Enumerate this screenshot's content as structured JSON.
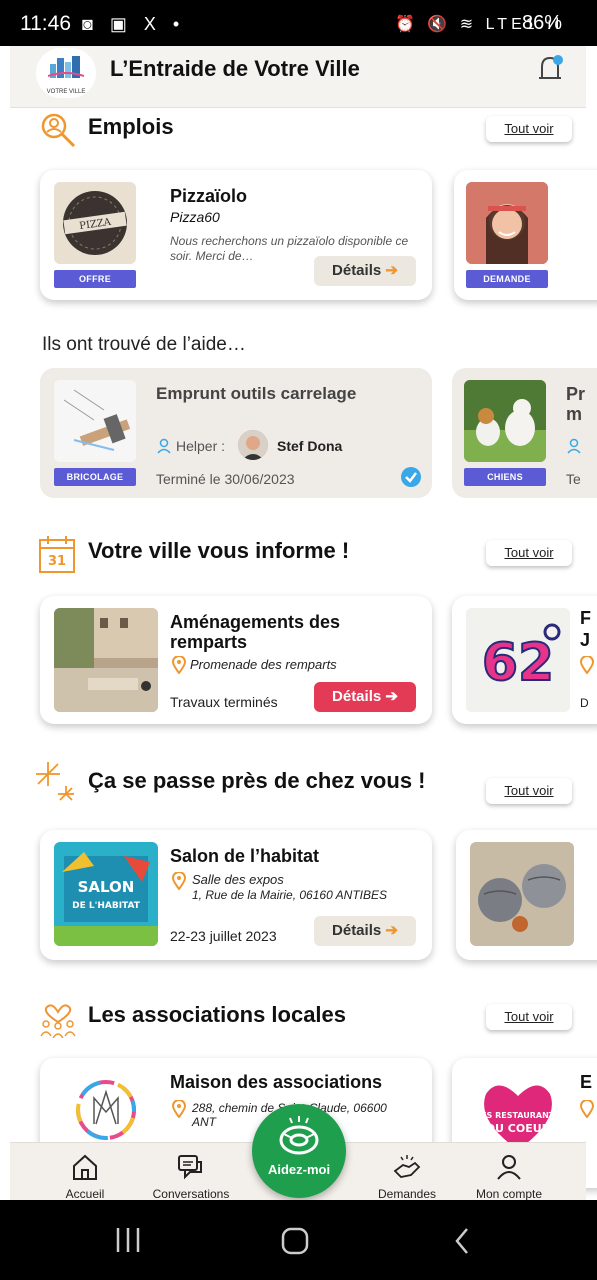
{
  "status_bar": {
    "time": "11:46",
    "left_icons": "◙ ▣ X •",
    "right_icons": "⏰ 🔇 ≋ LTE1 ıl",
    "battery": "86%"
  },
  "header": {
    "title": "L’Entraide de Votre Ville",
    "logo_caption": "VOTRE VILLE"
  },
  "emplois": {
    "title": "Emplois",
    "tout_voir": "Tout voir",
    "cards": [
      {
        "title": "Pizzaïolo",
        "subtitle": "Pizza60",
        "description": "Nous recherchons un pizzaïolo disponible ce soir. Merci de…",
        "tag": "OFFRE",
        "button": "Détails"
      },
      {
        "tag": "DEMANDE"
      }
    ]
  },
  "found_help": {
    "label": "Ils ont trouvé de l’aide…",
    "cards": [
      {
        "title": "Emprunt outils carrelage",
        "helper_label": "Helper :",
        "helper_name": "Stef Dona",
        "status": "Terminé le 30/06/2023",
        "tag": "BRICOLAGE"
      },
      {
        "title": "Pr",
        "title2": "m",
        "status": "Te",
        "tag": "CHIENS"
      }
    ]
  },
  "ville_informe": {
    "title": "Votre ville vous informe !",
    "tout_voir": "Tout voir",
    "cards": [
      {
        "title": "Aménagements des remparts",
        "location": "Promenade des remparts",
        "status": "Travaux terminés",
        "button": "Détails"
      },
      {
        "title": "F",
        "title2": "J",
        "footer": "D"
      }
    ]
  },
  "pres_de_vous": {
    "title": "Ça se passe près de chez vous !",
    "tout_voir": "Tout voir",
    "cards": [
      {
        "title": "Salon de l’habitat",
        "location": "Salle des expos",
        "address": "1, Rue de la Mairie, 06160 ANTIBES",
        "date": "22-23 juillet 2023",
        "button": "Détails",
        "image_text": "LE SALON DE L'HABITAT"
      }
    ]
  },
  "associations": {
    "title": "Les associations locales",
    "tout_voir": "Tout voir",
    "cards": [
      {
        "title": "Maison des associations",
        "address": "288, chemin de Saint-Claude, 06600 ANT"
      },
      {
        "title": "E",
        "image_text": "LES RESTAURANTS DU COEUR"
      }
    ]
  },
  "bottom_nav": {
    "items": [
      {
        "label": "Accueil"
      },
      {
        "label": "Conversations"
      },
      {
        "label": "Demandes"
      },
      {
        "label": "Mon compte"
      }
    ],
    "fab_label": "Aidez-moi"
  },
  "colors": {
    "accent_orange": "#f0962e",
    "tag_blue": "#5b5bd6",
    "details_red": "#e33b56",
    "fab_green": "#1f9e4e"
  }
}
